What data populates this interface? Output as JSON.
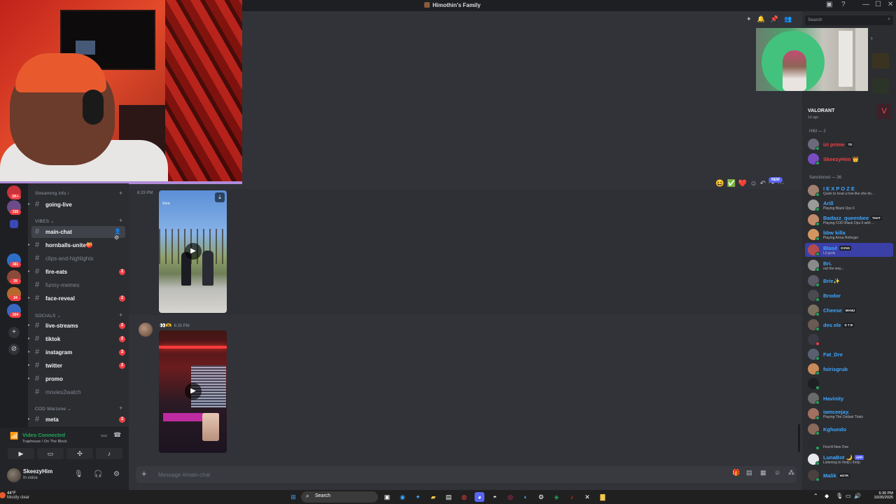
{
  "window": {
    "title": "Himothin's Family",
    "controls": {
      "minimize": "—",
      "maximize": "☐",
      "close": "✕"
    }
  },
  "server_rail": {
    "badges": [
      "1K+",
      "335",
      "381",
      "29",
      "24",
      "204"
    ]
  },
  "sidebar": {
    "categories": [
      {
        "label": "Streaming info"
      },
      {
        "label": "VIBES"
      },
      {
        "label": "SOCIALS"
      },
      {
        "label": "COD Warzone"
      }
    ],
    "channels": [
      {
        "name": "going-live",
        "muted": false,
        "mentions": ""
      },
      {
        "name": "main-chat",
        "muted": false,
        "mentions": "",
        "active": true
      },
      {
        "name": "hornballs-unite🍑",
        "muted": false,
        "mentions": ""
      },
      {
        "name": "clips-and-highlights",
        "muted": true,
        "mentions": ""
      },
      {
        "name": "fire-eats",
        "muted": false,
        "mentions": "2"
      },
      {
        "name": "funny-memes",
        "muted": true,
        "mentions": ""
      },
      {
        "name": "face-reveal",
        "muted": false,
        "mentions": "2"
      },
      {
        "name": "live-streams",
        "muted": false,
        "mentions": "2"
      },
      {
        "name": "tiktok",
        "muted": false,
        "mentions": "2"
      },
      {
        "name": "instagram",
        "muted": false,
        "mentions": "2"
      },
      {
        "name": "twitter",
        "muted": false,
        "mentions": "2"
      },
      {
        "name": "promo",
        "muted": false,
        "mentions": ""
      },
      {
        "name": "movies2watch",
        "muted": true,
        "mentions": ""
      },
      {
        "name": "meta",
        "muted": false,
        "mentions": "2"
      }
    ]
  },
  "voice": {
    "status": "Video Connected",
    "channel": "Traphouse / On The Block"
  },
  "user": {
    "name": "SkeezyHim",
    "status": "In voice"
  },
  "chat": {
    "messages": [
      {
        "time": "6:29 PM",
        "video_label": "Sora"
      },
      {
        "time": "6:30 PM"
      }
    ],
    "new_badge": "NEW",
    "composer_placeholder": "Message #main-chat"
  },
  "right": {
    "search_placeholder": "Search",
    "activity": {
      "title": "VALORANT",
      "sub": "1d ago"
    },
    "groups": [
      {
        "label": "HIM — 2"
      },
      {
        "label": "Sanctioned — 36"
      }
    ],
    "members": [
      {
        "name": "izi prime",
        "tag": "TD",
        "status": "",
        "color": "#f23f43"
      },
      {
        "name": "SkeezyHim",
        "tag": "",
        "status": "",
        "color": "#f23f43"
      },
      {
        "name": "I E X P O Z E",
        "tag": "",
        "status": "Quick to treat a hoe like she do...",
        "color": "#3ea6ff"
      },
      {
        "name": "Arill",
        "tag": "",
        "status": "Playing Black Ops 6",
        "color": "#3ea6ff"
      },
      {
        "name": "Badazz_queenbee",
        "tag": "THAT",
        "status": "Playing COD Black Ops 6 with ...",
        "color": "#3ea6ff"
      },
      {
        "name": "bbw killa",
        "tag": "",
        "status": "Playing Arma Reforger",
        "color": "#3ea6ff"
      },
      {
        "name": "Blasé",
        "tag": "GVNG",
        "status": "Lil gods",
        "color": "#3ea6ff"
      },
      {
        "name": "Bri.",
        "tag": "",
        "status": "out the way...",
        "color": "#3ea6ff"
      },
      {
        "name": "Brie✨",
        "tag": "",
        "status": "",
        "color": "#3ea6ff"
      },
      {
        "name": "Brodor",
        "tag": "",
        "status": "",
        "color": "#3ea6ff"
      },
      {
        "name": "Cheese",
        "tag": "MANU",
        "status": "",
        "color": "#3ea6ff"
      },
      {
        "name": "des ele",
        "tag": "D T B",
        "status": "",
        "color": "#3ea6ff"
      },
      {
        "name": "",
        "tag": "",
        "status": "",
        "color": "#7a2630"
      },
      {
        "name": "Fat_Dre",
        "tag": "",
        "status": "",
        "color": "#3ea6ff"
      },
      {
        "name": "foirisgrub",
        "tag": "",
        "status": "",
        "color": "#3ea6ff"
      },
      {
        "name": "",
        "tag": "",
        "status": "",
        "color": "#7a2630"
      },
      {
        "name": "Havinity",
        "tag": "",
        "status": "",
        "color": "#3ea6ff"
      },
      {
        "name": "iamceejay.",
        "tag": "",
        "status": "Playing The Outlast Trials",
        "color": "#3ea6ff"
      },
      {
        "name": "Kghundo",
        "tag": "",
        "status": "",
        "color": "#3ea6ff"
      },
      {
        "name": "",
        "tag": "",
        "status": "Find A New One",
        "color": "#7a2630"
      },
      {
        "name": "LunaBot 🌙",
        "tag": "APP",
        "status": "Listening to /help | /help",
        "color": "#3ea6ff"
      },
      {
        "name": "Malik",
        "tag": "HSTR",
        "status": "",
        "color": "#3ea6ff"
      }
    ]
  },
  "taskbar": {
    "weather_temp": "44°F",
    "weather_desc": "Mostly clear",
    "search": "Search",
    "time": "6:36 PM",
    "date": "10/26/2025"
  },
  "colors": {
    "accent": "#5865f2",
    "online": "#23a55a",
    "mention": "#f23f43"
  }
}
